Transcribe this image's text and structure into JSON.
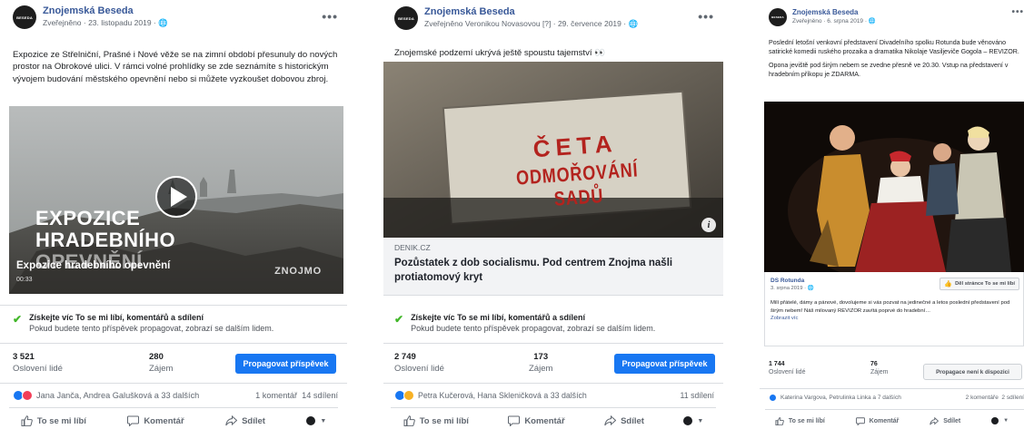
{
  "posts": [
    {
      "page_name": "Znojemská Beseda",
      "subtitle": "Zveřejněno · 23. listopadu 2019 · ",
      "avatar_text": "BESEDA",
      "text": [
        "Expozice ze Střelniční, Prašné i Nové věže se na zimní období přesunuly do nových prostor na Obrokové ulici. V rámci volné prohlídky se zde seznámíte s historickým vývojem budování městského opevnění nebo si můžete vyzkoušet dobovou zbroj."
      ],
      "video": {
        "overlay_title_1": "EXPOZICE",
        "overlay_title_2": "HRADEBNÍHO",
        "overlay_title_3": "OPEVNĚNÍ",
        "caption": "Expozice hradebního opevnění",
        "duration": "00:33",
        "brand": "ZNOJMO"
      },
      "boost_title": "Získejte víc To se mi líbí, komentářů a sdílení",
      "boost_sub": "Pokud budete tento příspěvek propagovat, zobrazí se dalším lidem.",
      "reach_value": "3 521",
      "reach_label": "Oslovení lidé",
      "engagement_value": "280",
      "engagement_label": "Zájem",
      "promote_label": "Propagovat příspěvek",
      "reactions_text": "Jana Janča, Andrea Galušková a 33 dalších",
      "comments_shares": "1 komentář  14 sdílení",
      "like_label": "To se mi líbí",
      "comment_label": "Komentář",
      "share_label": "Sdílet"
    },
    {
      "page_name": "Znojemská Beseda",
      "subtitle": "Zveřejněno Veronikou Novasovou [?] · 29. července 2019 · ",
      "avatar_text": "BESEDA",
      "text": [
        "Znojemské podzemí ukrývá ještě spoustu tajemství 👀"
      ],
      "sign_line1": "ČETA",
      "sign_line2": "ODMOŘOVÁNÍ SADŮ",
      "link_domain": "DENIK.CZ",
      "link_title": "Pozůstatek z dob socialismu. Pod centrem Znojma našli protiatomový kryt",
      "boost_title": "Získejte víc To se mi líbí, komentářů a sdílení",
      "boost_sub": "Pokud budete tento příspěvek propagovat, zobrazí se dalším lidem.",
      "reach_value": "2 749",
      "reach_label": "Oslovení lidé",
      "engagement_value": "173",
      "engagement_label": "Zájem",
      "promote_label": "Propagovat příspěvek",
      "reactions_text": "Petra Kučerová, Hana Skleničková a 33 dalších",
      "comments_shares": "11 sdílení",
      "like_label": "To se mi líbí",
      "comment_label": "Komentář",
      "share_label": "Sdílet"
    },
    {
      "page_name": "Znojemská Beseda",
      "subtitle": "Zveřejněno · 6. srpna 2019 · ",
      "avatar_text": "BESEDA",
      "text": [
        "Poslední letošní venkovní představení Divadelního spolku Rotunda bude věnováno satirické komedii ruského prozaika a dramatika Nikolaje Vasiljeviče Gogola – REVIZOR.",
        "Opona jeviště pod širým nebem se zvedne přesně ve 20.30. Vstup na představení v hradebním příkopu je ZDARMA."
      ],
      "shared_page": "DS Rotunda",
      "shared_date": "3. srpna 2019 · ",
      "shared_like_btn": "Děl stránce To se mi líbí",
      "shared_text": "Milí přátelé, dámy a pánové, dovolujeme si vás pozvat na jedinečné a letos poslední představení pod širým nebem! Náš milovaný REVIZOR zavítá poprvé do hradební…",
      "shared_more": "Zobrazit víc",
      "reach_value": "1 744",
      "reach_label": "Oslovení lidé",
      "engagement_value": "76",
      "engagement_label": "Zájem",
      "promote_label": "Propagace není k dispozici",
      "reactions_text": "Katerina Vargova, Petrulinka Linka a 7 dalších",
      "comments_shares": "2 komentáře  2 sdílení",
      "like_label": "To se mi líbí",
      "comment_label": "Komentář",
      "share_label": "Sdílet"
    }
  ],
  "colors": {
    "fb_blue": "#1877f2",
    "link_blue": "#385898",
    "like_blue": "#1877f2",
    "love_red": "#f33e58",
    "haha_yellow": "#f7b125",
    "check_green": "#42b72a"
  },
  "icons": [
    "globe-icon",
    "more-options-icon",
    "play-icon",
    "info-icon",
    "check-icon",
    "like-icon",
    "comment-icon",
    "share-icon",
    "audience-icon",
    "thumbs-up-icon"
  ]
}
